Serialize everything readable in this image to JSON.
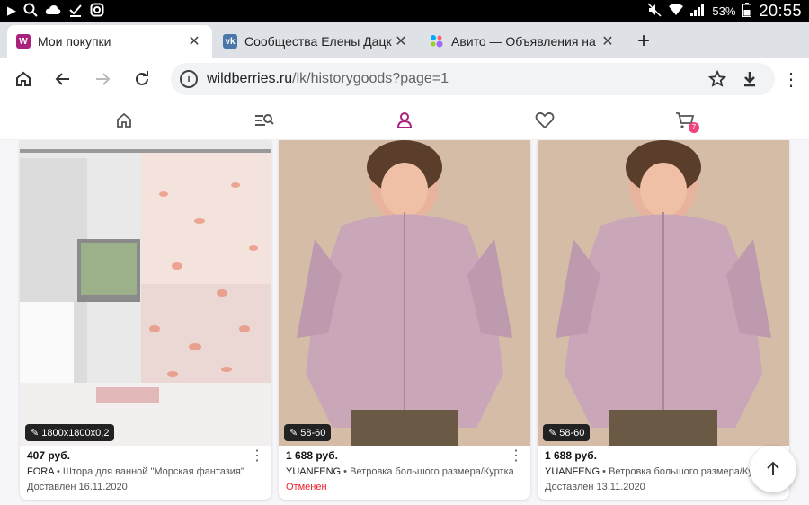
{
  "status_bar": {
    "time": "20:55",
    "battery": "53%"
  },
  "tabs": [
    {
      "title": "Мои покупки",
      "favicon_color": "#a9237e",
      "favicon_letter": "W",
      "active": true
    },
    {
      "title": "Сообщества Елены Дацкевич",
      "favicon_color": "#4a76a8",
      "favicon_letter": "vk",
      "active": false
    },
    {
      "title": "Авито — Объявления на сайте",
      "favicon_color": "#fff",
      "favicon_letter": "",
      "active": false
    }
  ],
  "address": {
    "host": "wildberries.ru",
    "path": "/lk/historygoods?page=1"
  },
  "site_nav": {
    "cart_count": "7"
  },
  "products": [
    {
      "size": "1800x1800x0,2",
      "price": "407 руб.",
      "brand": "FORA",
      "name": "Штора для ванной \"Морская фантазия\"",
      "status": "Доставлен 16.11.2020",
      "canceled": false
    },
    {
      "size": "58-60",
      "price": "1 688 руб.",
      "brand": "YUANFENG",
      "name": "Ветровка большого размера/Куртка",
      "status": "Отменен",
      "canceled": true
    },
    {
      "size": "58-60",
      "price": "1 688 руб.",
      "brand": "YUANFENG",
      "name": "Ветровка большого размера/Куртка",
      "status": "Доставлен 13.11.2020",
      "canceled": false
    }
  ],
  "colors": {
    "accent": "#a9237e",
    "canceled": "#e8222f",
    "badge": "#f0437c"
  }
}
